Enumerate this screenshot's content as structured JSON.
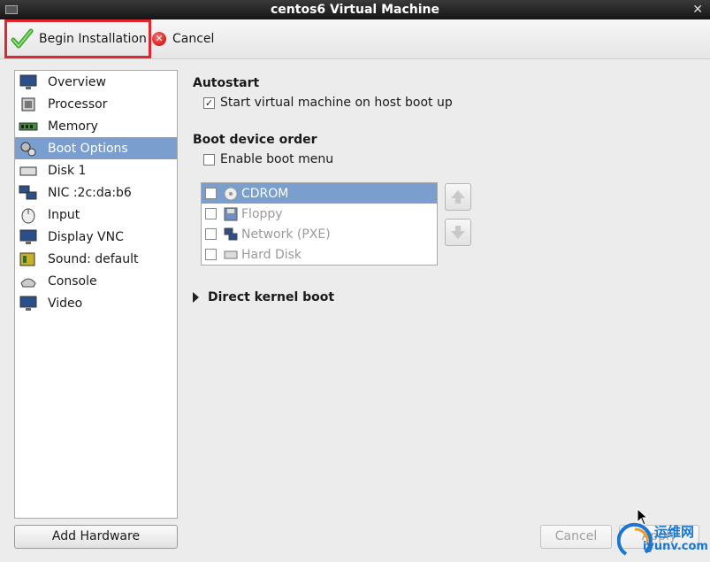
{
  "window": {
    "title": "centos6 Virtual Machine"
  },
  "toolbar": {
    "begin_label": "Begin Installation",
    "cancel_label": "Cancel"
  },
  "sidebar": {
    "items": [
      {
        "label": "Overview",
        "icon": "monitor-icon"
      },
      {
        "label": "Processor",
        "icon": "cpu-icon"
      },
      {
        "label": "Memory",
        "icon": "memory-icon"
      },
      {
        "label": "Boot Options",
        "icon": "gears-icon",
        "selected": true
      },
      {
        "label": "Disk 1",
        "icon": "disk-icon"
      },
      {
        "label": "NIC :2c:da:b6",
        "icon": "network-icon"
      },
      {
        "label": "Input",
        "icon": "mouse-icon"
      },
      {
        "label": "Display VNC",
        "icon": "monitor-icon"
      },
      {
        "label": "Sound: default",
        "icon": "sound-card-icon"
      },
      {
        "label": "Console",
        "icon": "console-icon"
      },
      {
        "label": "Video",
        "icon": "monitor-icon"
      }
    ],
    "add_hardware_label": "Add Hardware"
  },
  "autostart": {
    "title": "Autostart",
    "checkbox_label": "Start virtual machine on host boot up",
    "checked": true
  },
  "boot_order": {
    "title": "Boot device order",
    "enable_menu_label": "Enable boot menu",
    "enable_menu_checked": false,
    "devices": [
      {
        "label": "CDROM",
        "icon": "cdrom-icon",
        "checked": false,
        "selected": true
      },
      {
        "label": "Floppy",
        "icon": "floppy-icon",
        "checked": false
      },
      {
        "label": "Network (PXE)",
        "icon": "network-icon",
        "checked": false
      },
      {
        "label": "Hard Disk",
        "icon": "disk-icon",
        "checked": false
      }
    ]
  },
  "direct_kernel": {
    "label": "Direct kernel boot"
  },
  "footer": {
    "cancel_label": "Cancel",
    "apply_label": "Apply"
  },
  "watermark": {
    "text": "运维网",
    "sub": "iyunv.com"
  },
  "colors": {
    "selection": "#7a9fcf",
    "highlight_border": "#e0262e"
  }
}
